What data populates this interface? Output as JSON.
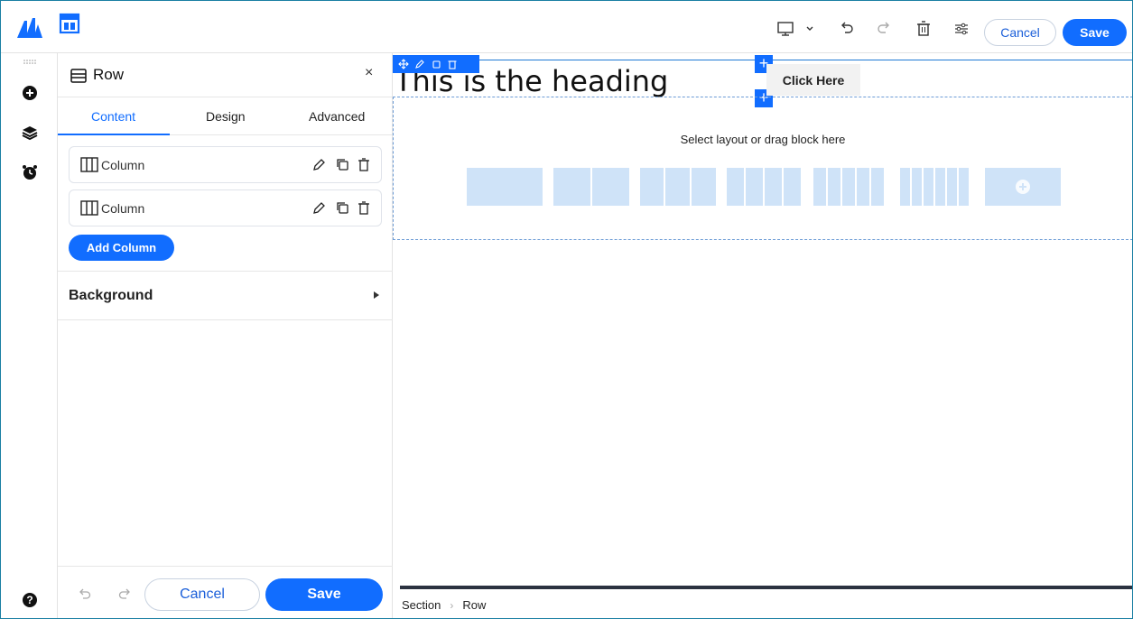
{
  "topbar": {
    "cancel_label": "Cancel",
    "save_label": "Save",
    "brand_color": "#116dff"
  },
  "panel": {
    "title": "Row",
    "close_glyph": "×",
    "tabs": [
      {
        "label": "Content",
        "active": true
      },
      {
        "label": "Design",
        "active": false
      },
      {
        "label": "Advanced",
        "active": false
      }
    ],
    "columns": [
      {
        "label": "Column"
      },
      {
        "label": "Column"
      }
    ],
    "add_column_label": "Add Column",
    "background_label": "Background",
    "footer": {
      "cancel_label": "Cancel",
      "save_label": "Save"
    }
  },
  "canvas": {
    "heading_text": "This is the heading",
    "button_text": "Click Here",
    "layout_prompt": "Select layout or drag block here",
    "layout_options": [
      1,
      2,
      3,
      4,
      5,
      6
    ],
    "layout_fill_color": "#cfe3f8"
  },
  "breadcrumb": {
    "items": [
      "Section",
      "Row"
    ]
  }
}
